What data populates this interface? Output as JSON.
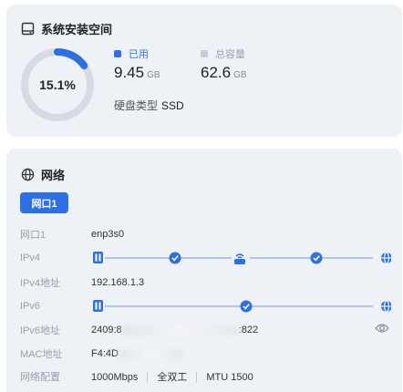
{
  "storage": {
    "title": "系统安装空间",
    "used_percent_label": "15.1%",
    "used_fraction": 0.151,
    "used_label": "已用",
    "used_value": "9.45",
    "used_unit": "GB",
    "total_label": "总容量",
    "total_value": "62.6",
    "total_unit": "GB",
    "disk_type_label": "硬盘类型",
    "disk_type_value": "SSD",
    "colors": {
      "used": "#2f6fe4",
      "track": "#d6dbe3",
      "total": "#c7ccd4"
    }
  },
  "network": {
    "title": "网络",
    "tabs": [
      {
        "label": "网口1",
        "active": true
      }
    ],
    "rows": {
      "port": {
        "label": "网口1",
        "value": "enp3s0"
      },
      "ipv4": {
        "label": "IPv4"
      },
      "ipv4_addr": {
        "label": "IPv4地址",
        "value": "192.168.1.3"
      },
      "ipv6": {
        "label": "IPv6"
      },
      "ipv6_addr": {
        "label": "IPv6地址",
        "value_prefix": "2409:8",
        "value_suffix": ":822"
      },
      "mac": {
        "label": "MAC地址",
        "value_prefix": "F4:4D"
      },
      "config": {
        "label": "网络配置",
        "speed": "1000Mbps",
        "duplex": "全双工",
        "mtu": "MTU 1500"
      }
    },
    "icons": {
      "ipv4_path": [
        "device-icon",
        "check-circle-icon",
        "router-icon",
        "check-circle-icon",
        "globe-icon"
      ],
      "ipv6_path": [
        "device-icon",
        "check-circle-icon",
        "globe-icon"
      ],
      "ipv6_reveal": "eye-icon"
    },
    "colors": {
      "accent": "#2f6fe4",
      "line": "#9ab8ee",
      "tab_bg": "#2f6fe4"
    }
  }
}
